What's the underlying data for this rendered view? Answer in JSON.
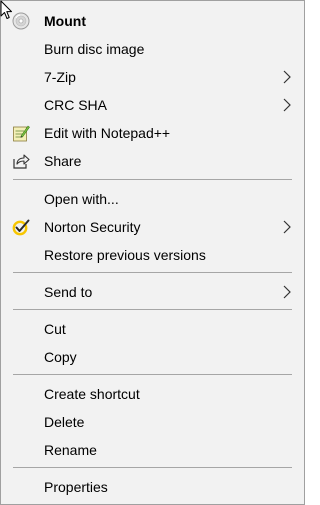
{
  "menu": {
    "items": [
      {
        "id": "mount",
        "label": "Mount",
        "bold": true,
        "icon": "disc-icon"
      },
      {
        "id": "burn-disc-image",
        "label": "Burn disc image"
      },
      {
        "id": "7-zip",
        "label": "7-Zip",
        "submenu": true
      },
      {
        "id": "crc-sha",
        "label": "CRC SHA",
        "submenu": true
      },
      {
        "id": "edit-with-notepad",
        "label": "Edit with Notepad++",
        "icon": "notepad-plus-plus-icon"
      },
      {
        "id": "share",
        "label": "Share",
        "icon": "share-icon"
      },
      {
        "id": "open-with",
        "label": "Open with..."
      },
      {
        "id": "norton-security",
        "label": "Norton Security",
        "submenu": true,
        "icon": "norton-checkmark-icon"
      },
      {
        "id": "restore-previous-versions",
        "label": "Restore previous versions"
      },
      {
        "id": "send-to",
        "label": "Send to",
        "submenu": true
      },
      {
        "id": "cut",
        "label": "Cut"
      },
      {
        "id": "copy",
        "label": "Copy"
      },
      {
        "id": "create-shortcut",
        "label": "Create shortcut"
      },
      {
        "id": "delete",
        "label": "Delete"
      },
      {
        "id": "rename",
        "label": "Rename"
      },
      {
        "id": "properties",
        "label": "Properties"
      }
    ]
  },
  "colors": {
    "menu_background": "#f2f2f2",
    "border": "#a0a0a0",
    "separator": "#a6a6a6",
    "norton_yellow": "#f7c600"
  }
}
